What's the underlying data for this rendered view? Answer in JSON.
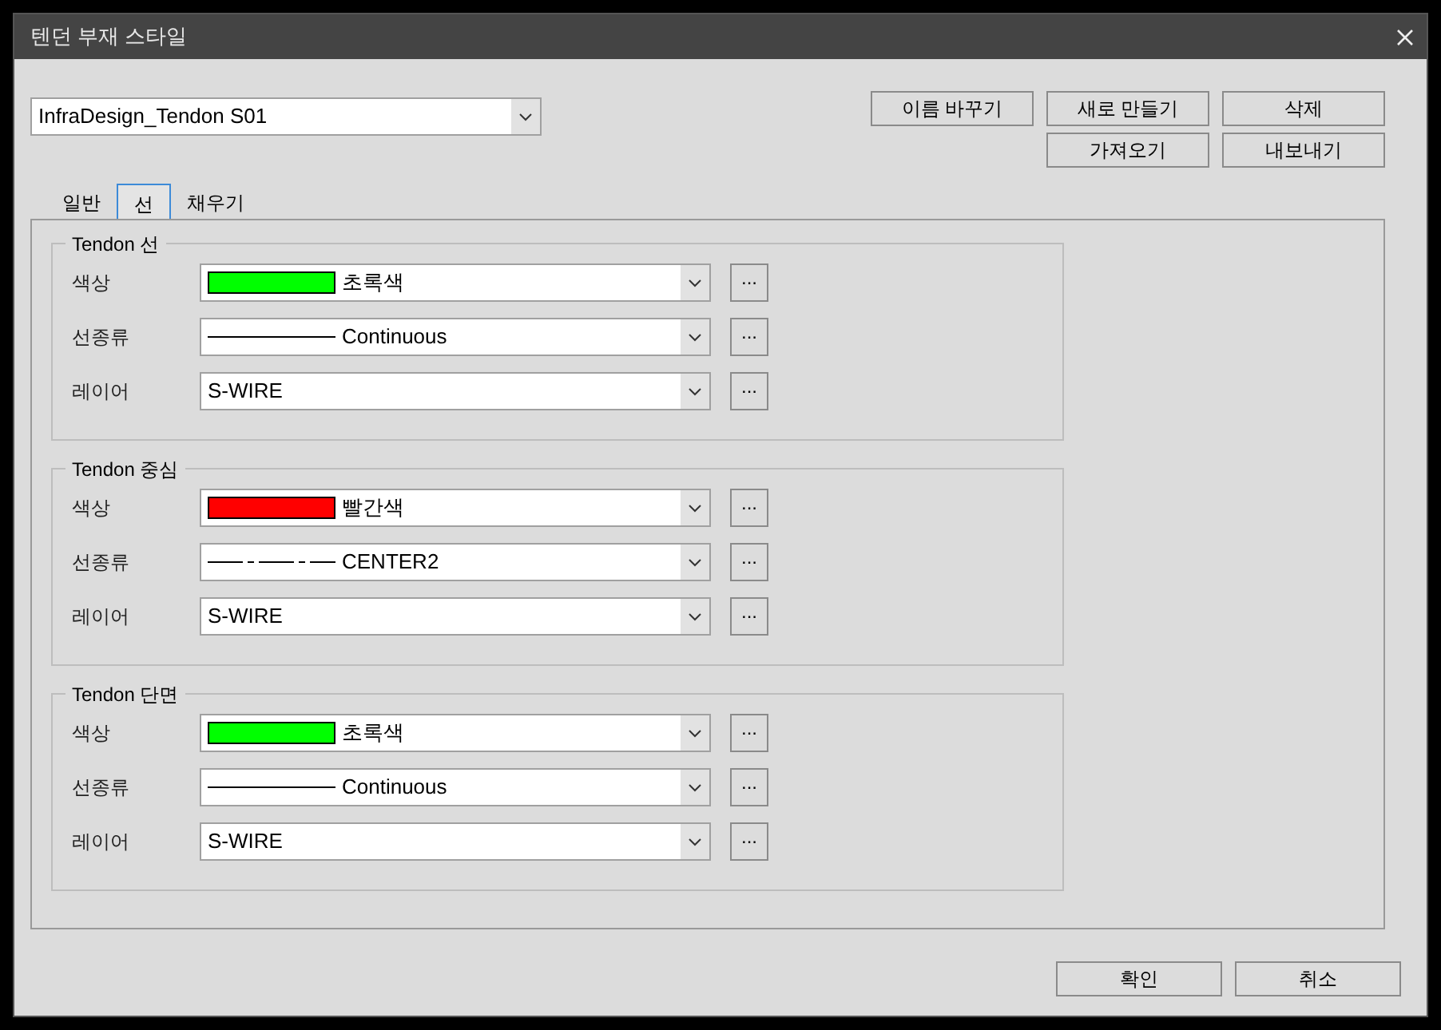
{
  "window": {
    "title": "텐던 부재 스타일"
  },
  "style_select": {
    "value": "InfraDesign_Tendon S01"
  },
  "button_rows": [
    [
      "이름 바꾸기",
      "새로 만들기",
      "삭제"
    ],
    [
      "가져오기",
      "내보내기"
    ]
  ],
  "tabs": [
    {
      "label": "일반",
      "selected": false
    },
    {
      "label": "선",
      "selected": true
    },
    {
      "label": "채우기",
      "selected": false
    }
  ],
  "groups": [
    {
      "title": "Tendon 선",
      "rows": [
        {
          "kind": "color",
          "label": "색상",
          "value": "초록색",
          "color": "#00ff00",
          "button": "..."
        },
        {
          "kind": "linetype",
          "label": "선종류",
          "value": "Continuous",
          "dashed": false,
          "button": "..."
        },
        {
          "kind": "layer",
          "label": "레이어",
          "value": "S-WIRE",
          "button": "..."
        }
      ]
    },
    {
      "title": "Tendon 중심",
      "rows": [
        {
          "kind": "color",
          "label": "색상",
          "value": "빨간색",
          "color": "#ff0000",
          "button": "..."
        },
        {
          "kind": "linetype",
          "label": "선종류",
          "value": "CENTER2",
          "dashed": true,
          "button": "..."
        },
        {
          "kind": "layer",
          "label": "레이어",
          "value": "S-WIRE",
          "button": "..."
        }
      ]
    },
    {
      "title": "Tendon 단면",
      "rows": [
        {
          "kind": "color",
          "label": "색상",
          "value": "초록색",
          "color": "#00ff00",
          "button": "..."
        },
        {
          "kind": "linetype",
          "label": "선종류",
          "value": "Continuous",
          "dashed": false,
          "button": "..."
        },
        {
          "kind": "layer",
          "label": "레이어",
          "value": "S-WIRE",
          "button": "..."
        }
      ]
    }
  ],
  "footer_buttons": [
    "확인",
    "취소"
  ]
}
